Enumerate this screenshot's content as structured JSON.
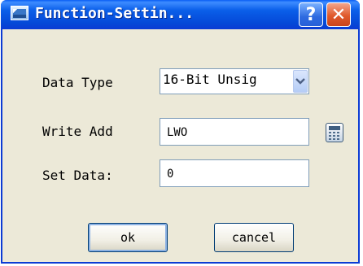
{
  "window": {
    "title": "Function-Settin...",
    "help_glyph": "?",
    "close_glyph": "✕",
    "icon": "app-window-icon"
  },
  "form": {
    "data_type": {
      "label": "Data Type",
      "selected": "16-Bit Unsig",
      "dropdown_icon": "chevron-down-icon"
    },
    "write_add": {
      "label": "Write Add",
      "value": "LWO",
      "side_icon": "calculator-icon"
    },
    "set_data": {
      "label": "Set Data:",
      "value": "0"
    }
  },
  "buttons": {
    "ok": "ok",
    "cancel": "cancel"
  },
  "colors": {
    "titlebar": "#0548d7",
    "window_bg": "#ece9d8",
    "close_btn": "#e05a2b",
    "help_btn": "#2e6ae0"
  }
}
